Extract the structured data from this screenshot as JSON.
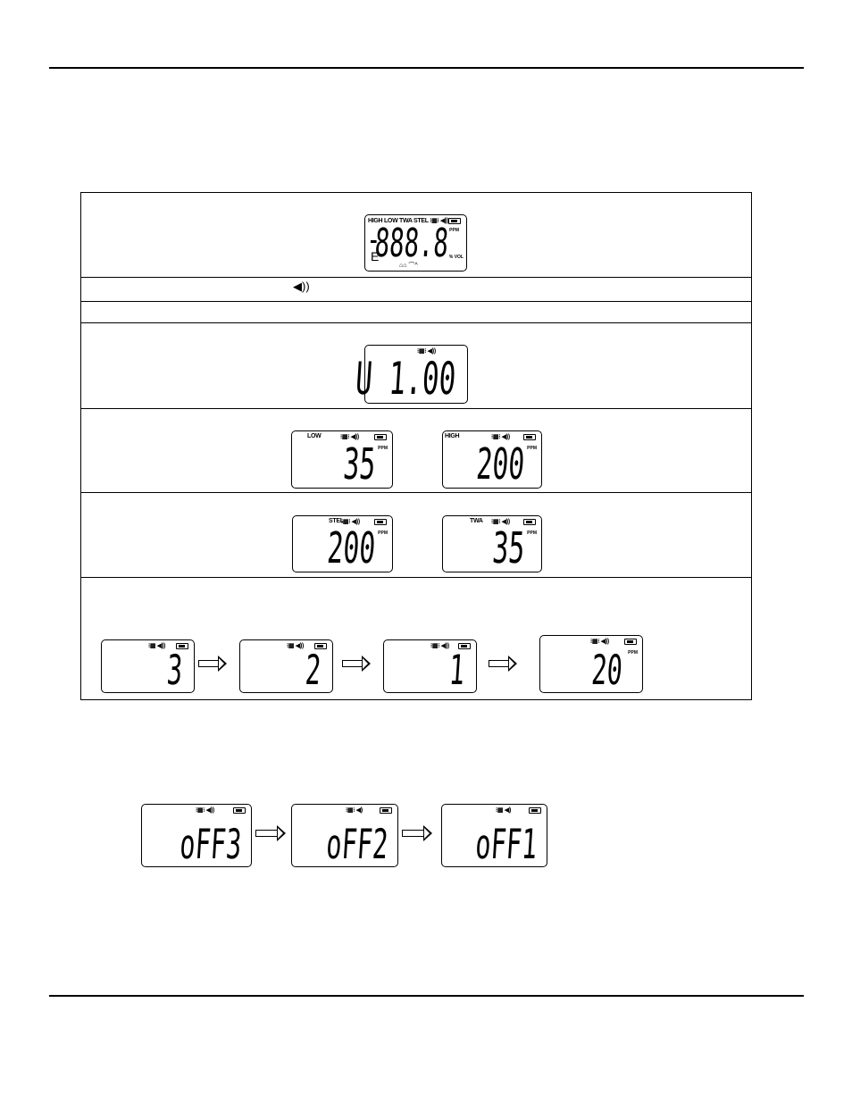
{
  "icons": {
    "speaker": "speaker-icon",
    "battery": "battery-icon",
    "arrow": "right-arrow-icon"
  },
  "test_lcd": {
    "labels": "HIGH  LOW  TWA  STEL  ⁝▦⁝  ◀))",
    "minus": "-",
    "digits": "888.8",
    "e": "E",
    "ppm": "PPM",
    "vol": "% VOL",
    "bottom": "⌂⌂   ⌒^"
  },
  "speaker_row_icon": "◀))",
  "version_lcd": {
    "labels": "⁝▦⁝ ◀))",
    "digits": "U 1.00"
  },
  "alarm_lcds": [
    {
      "label": "LOW",
      "digits": "35",
      "ppm": "PPM"
    },
    {
      "label": "HIGH",
      "digits": "200",
      "ppm": "PPM"
    },
    {
      "label": "STEL",
      "digits": "200",
      "ppm": "PPM"
    },
    {
      "label": "TWA",
      "digits": "35",
      "ppm": "PPM"
    }
  ],
  "countdown_lcds": [
    {
      "labels": "⁝▦ ◀))",
      "digits": "3"
    },
    {
      "labels": "⁝▦ ◀))",
      "digits": "2"
    },
    {
      "labels": "⁝▦⁝ ◀))",
      "digits": "1"
    },
    {
      "labels": "⁝▦⁝ ◀))",
      "digits": "20",
      "ppm": "PPM"
    }
  ],
  "off_lcds": [
    {
      "labels": "⁝▦⁝ ◀))",
      "digits": "oFF3"
    },
    {
      "labels": "⁝▦⁝ ◀)",
      "digits": "oFF2"
    },
    {
      "labels": "⁝▦ ◀)",
      "digits": "oFF1"
    }
  ]
}
